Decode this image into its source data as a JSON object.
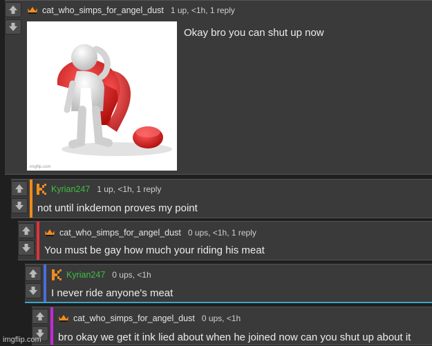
{
  "comments": [
    {
      "username": "cat_who_simps_for_angel_dust",
      "meta": "1 up, <1h, 1 reply",
      "text": "Okay bro you can shut up now",
      "user_color": "#e6e6e6",
      "rail_color": "",
      "icon": "crown-icon"
    },
    {
      "username": "Kyrian247",
      "meta": "1 up, <1h, 1 reply",
      "text": "not until inkdemon proves my point",
      "user_color": "#3fbf3f",
      "rail_color": "#f08a1a",
      "icon": "k-pixel-icon"
    },
    {
      "username": "cat_who_simps_for_angel_dust",
      "meta": "0 ups, <1h, 1 reply",
      "text": "You must be gay how much your riding his meat",
      "user_color": "#e6e6e6",
      "rail_color": "#e0323c",
      "icon": "crown-icon"
    },
    {
      "username": "Kyrian247",
      "meta": "0 ups, <1h",
      "text": "I never ride anyone's meat",
      "user_color": "#3fbf3f",
      "rail_color": "#4b6cd8",
      "icon": "k-pixel-icon"
    },
    {
      "username": "cat_who_simps_for_angel_dust",
      "meta": "0 ups, <1h",
      "text": "bro okay we get it ink lied about when he joined now can you shut up about it",
      "user_color": "#e6e6e6",
      "rail_color": "#c22ad8",
      "icon": "crown-icon"
    }
  ],
  "image_watermark": "imgflip.com",
  "site_watermark": "imgflip.com"
}
